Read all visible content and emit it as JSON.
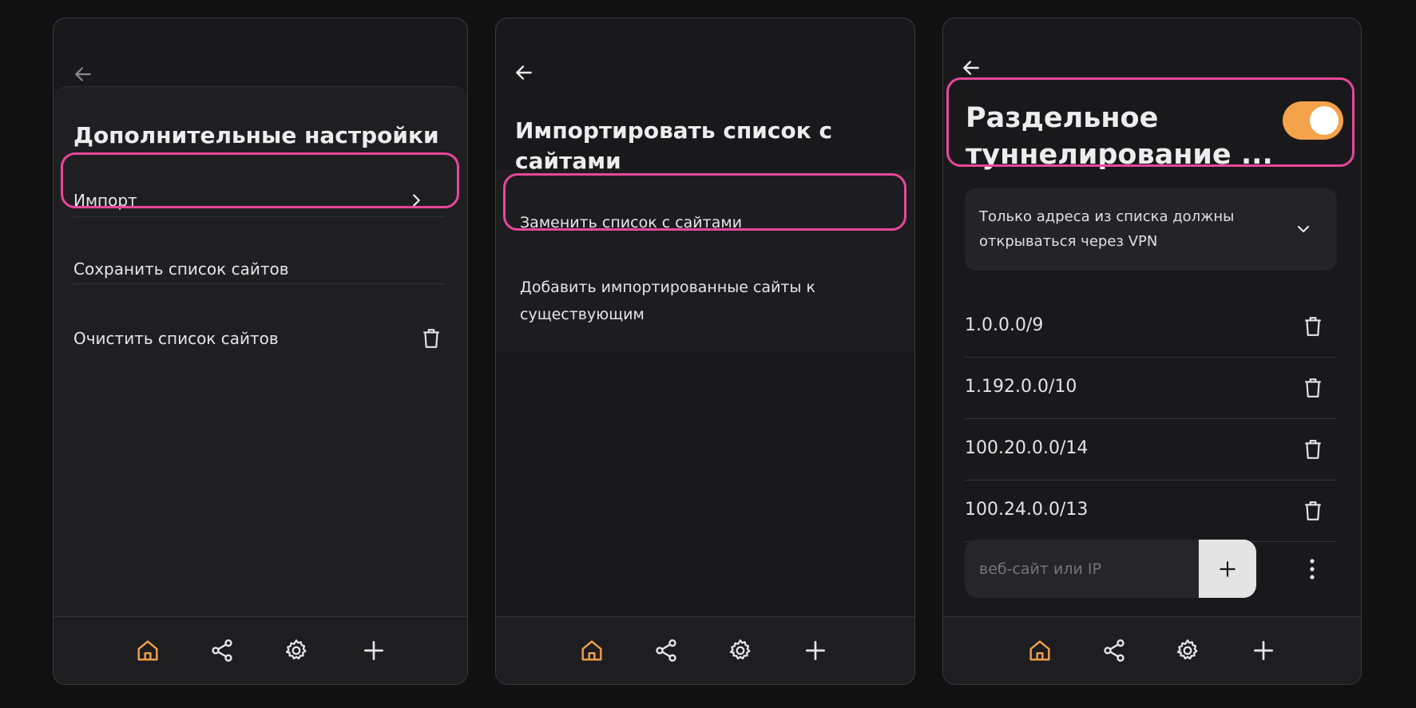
{
  "panel1": {
    "title": "Дополнительные настройки",
    "items": [
      {
        "label": "Импорт",
        "icon": "chevron-right-icon"
      },
      {
        "label": "Сохранить список сайтов"
      },
      {
        "label": "Очистить список сайтов",
        "icon": "trash-icon"
      }
    ]
  },
  "panel2": {
    "title_line1": "Импортировать список с",
    "title_line2": "сайтами",
    "items": [
      {
        "label": "Заменить список с сайтами"
      },
      {
        "label_line1": "Добавить импортированные сайты к",
        "label_line2": "существующим"
      }
    ]
  },
  "panel3": {
    "title_line1": "Раздельное",
    "title_line2": "туннелирование ...",
    "toggle_on": true,
    "mode_line1": "Только адреса из списка должны",
    "mode_line2": "открываться через VPN",
    "ips": [
      "1.0.0.0/9",
      "1.192.0.0/10",
      "100.20.0.0/14",
      "100.24.0.0/13"
    ],
    "input_placeholder": "веб-сайт или IP"
  },
  "nav": {
    "icons": [
      "home-icon",
      "share-icon",
      "gear-icon",
      "plus-icon"
    ]
  },
  "colors": {
    "accent": "#f4a34a",
    "highlight": "#e8479a",
    "background": "#111112",
    "panel": "#19191b"
  }
}
